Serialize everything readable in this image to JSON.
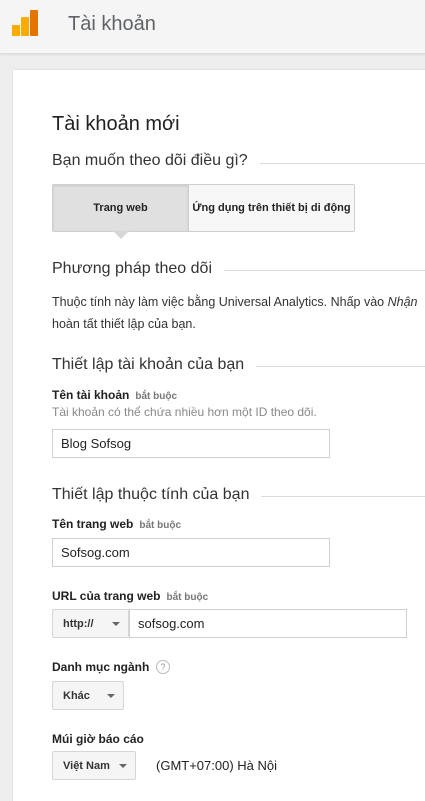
{
  "header": {
    "title": "Tài khoản",
    "logo_icon": "analytics-logo-icon"
  },
  "page_title": "Tài khoản mới",
  "tracking_question": "Bạn muốn theo dõi điều gì?",
  "tracking_options": [
    "Trang web",
    "Ứng dụng trên thiết bị di động"
  ],
  "method": {
    "title": "Phương pháp theo dõi",
    "text_before": "Thuộc tính này làm việc bằng Universal Analytics. Nhấp vào ",
    "text_em": "Nhận",
    "text_after": "hoàn tất thiết lập của bạn."
  },
  "account_setup": {
    "title": "Thiết lập tài khoản của bạn",
    "name_label": "Tên tài khoản",
    "required": "bắt buộc",
    "hint": "Tài khoản có thể chứa nhiều hơn một ID theo dõi.",
    "name_value": "Blog Sofsog"
  },
  "property_setup": {
    "title": "Thiết lập thuộc tính của bạn",
    "site_name_label": "Tên trang web",
    "site_name_value": "Sofsog.com",
    "url_label": "URL của trang web",
    "protocol": "http://",
    "url_value": "sofsog.com",
    "industry_label": "Danh mục ngành",
    "industry_help": "?",
    "industry_value": "Khác",
    "timezone_label": "Múi giờ báo cáo",
    "country_value": "Việt Nam",
    "timezone_value": "(GMT+07:00) Hà Nội"
  },
  "colors": {
    "logo_light": "#f9ab00",
    "logo_dark": "#e37400"
  }
}
